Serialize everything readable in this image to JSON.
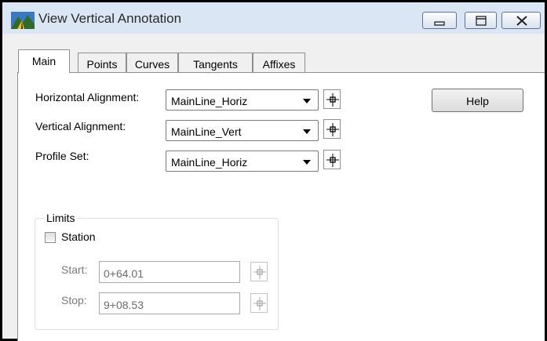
{
  "window": {
    "title": "View Vertical Annotation",
    "controls": [
      "minimize",
      "maximize",
      "close"
    ]
  },
  "tabs": [
    {
      "label": "Main",
      "active": true
    },
    {
      "label": "Points",
      "active": false
    },
    {
      "label": "Curves",
      "active": false
    },
    {
      "label": "Tangents",
      "active": false
    },
    {
      "label": "Affixes",
      "active": false
    }
  ],
  "main": {
    "horizontal_alignment": {
      "label": "Horizontal Alignment:",
      "value": "MainLine_Horiz"
    },
    "vertical_alignment": {
      "label": "Vertical Alignment:",
      "value": "MainLine_Vert"
    },
    "profile_set": {
      "label": "Profile Set:",
      "value": "MainLine_Horiz"
    },
    "help_label": "Help"
  },
  "limits": {
    "title": "Limits",
    "station_label": "Station",
    "station_checked": false,
    "start_label": "Start:",
    "start_value": "0+64.01",
    "stop_label": "Stop:",
    "stop_value": "9+08.53"
  },
  "icons": {
    "app": "road-profile-icon",
    "pick": "crosshair-pick-icon"
  }
}
